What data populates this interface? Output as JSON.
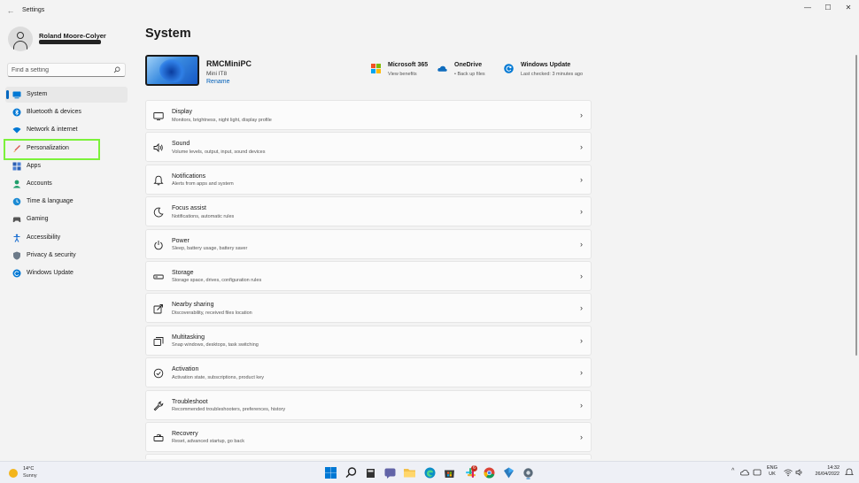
{
  "window": {
    "title": "Settings",
    "back_glyph": "←",
    "controls": {
      "minimize": "—",
      "maximize": "☐",
      "close": "✕"
    }
  },
  "user": {
    "name": "Roland Moore-Colyer",
    "avatar_icon": "user-avatar-icon"
  },
  "search": {
    "placeholder": "Find a setting",
    "icon": "search-icon"
  },
  "nav": {
    "items": [
      {
        "label": "System",
        "icon": "monitor-icon",
        "active": true
      },
      {
        "label": "Bluetooth & devices",
        "icon": "bluetooth-icon"
      },
      {
        "label": "Network & internet",
        "icon": "wifi-icon"
      },
      {
        "label": "Personalization",
        "icon": "brush-icon",
        "highlighted": true
      },
      {
        "label": "Apps",
        "icon": "apps-icon"
      },
      {
        "label": "Accounts",
        "icon": "person-icon"
      },
      {
        "label": "Time & language",
        "icon": "globe-clock-icon"
      },
      {
        "label": "Gaming",
        "icon": "gamepad-icon"
      },
      {
        "label": "Accessibility",
        "icon": "accessibility-icon"
      },
      {
        "label": "Privacy & security",
        "icon": "shield-icon"
      },
      {
        "label": "Windows Update",
        "icon": "update-icon"
      }
    ],
    "highlight_color": "#7cf13a",
    "accent_color": "#0067c0"
  },
  "main": {
    "title": "System",
    "device": {
      "name": "RMCMiniPC",
      "model": "Mini IT8",
      "rename_label": "Rename"
    },
    "quick_links": [
      {
        "title": "Microsoft 365",
        "subtitle": "View benefits",
        "icon": "microsoft-365-icon"
      },
      {
        "title": "OneDrive",
        "subtitle": "• Back up files",
        "icon": "onedrive-cloud-icon"
      },
      {
        "title": "Windows Update",
        "subtitle": "Last checked: 3 minutes ago",
        "icon": "windows-update-icon"
      }
    ],
    "settings": [
      {
        "title": "Display",
        "subtitle": "Monitors, brightness, night light, display profile",
        "icon": "display-icon"
      },
      {
        "title": "Sound",
        "subtitle": "Volume levels, output, input, sound devices",
        "icon": "speaker-icon"
      },
      {
        "title": "Notifications",
        "subtitle": "Alerts from apps and system",
        "icon": "bell-icon"
      },
      {
        "title": "Focus assist",
        "subtitle": "Notifications, automatic rules",
        "icon": "moon-icon"
      },
      {
        "title": "Power",
        "subtitle": "Sleep, battery usage, battery saver",
        "icon": "power-icon"
      },
      {
        "title": "Storage",
        "subtitle": "Storage space, drives, configuration rules",
        "icon": "storage-drive-icon"
      },
      {
        "title": "Nearby sharing",
        "subtitle": "Discoverability, received files location",
        "icon": "share-icon"
      },
      {
        "title": "Multitasking",
        "subtitle": "Snap windows, desktops, task switching",
        "icon": "multitasking-icon"
      },
      {
        "title": "Activation",
        "subtitle": "Activation state, subscriptions, product key",
        "icon": "check-circle-icon"
      },
      {
        "title": "Troubleshoot",
        "subtitle": "Recommended troubleshooters, preferences, history",
        "icon": "wrench-icon"
      },
      {
        "title": "Recovery",
        "subtitle": "Reset, advanced startup, go back",
        "icon": "recovery-icon"
      }
    ],
    "chevron": "›"
  },
  "taskbar": {
    "weather": {
      "temp": "14°C",
      "condition": "Sunny"
    },
    "apps": [
      "windows-start-icon",
      "search-icon",
      "file-icon",
      "teams-chat-icon",
      "file-explorer-icon",
      "edge-icon",
      "store-icon",
      "slack-icon",
      "chrome-icon",
      "vpn-icon",
      "settings-gear-icon"
    ],
    "slack_badge": "6",
    "tray_chevron": "^",
    "language": {
      "line1": "ENG",
      "line2": "UK"
    },
    "clock": {
      "time": "14:32",
      "date": "26/04/2022"
    }
  }
}
